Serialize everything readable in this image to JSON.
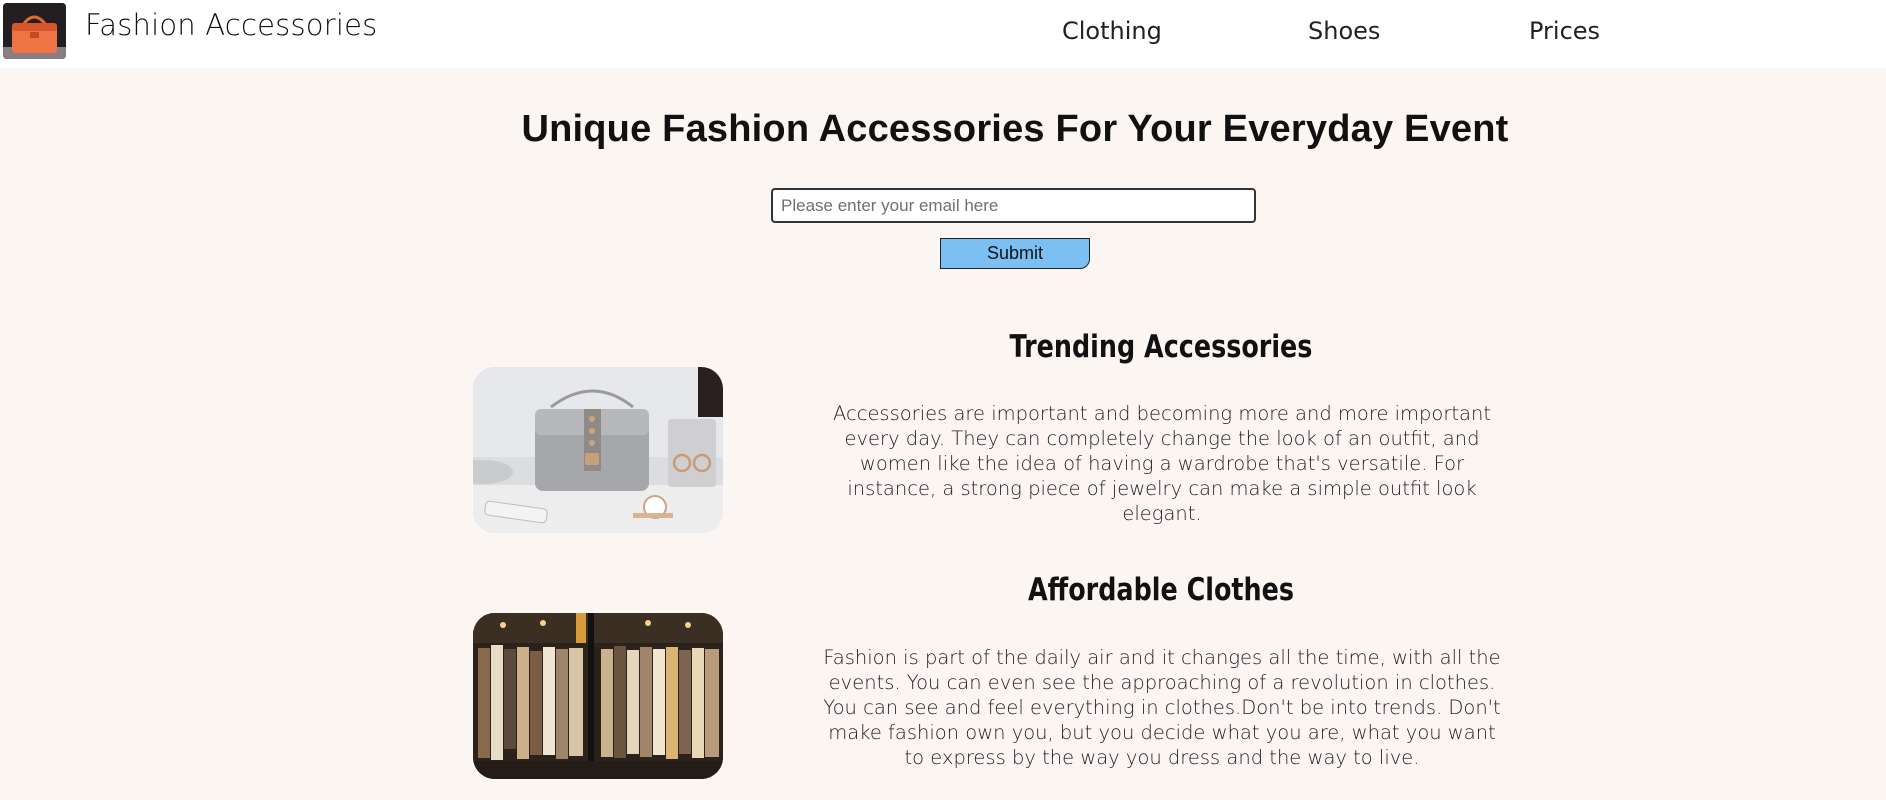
{
  "header": {
    "brand": "Fashion Accessories",
    "nav": {
      "clothing": "Clothing",
      "shoes": "Shoes",
      "prices": "Prices"
    }
  },
  "hero": {
    "title": "Unique Fashion Accessories For Your Everyday Event",
    "email_placeholder": "Please enter your email here",
    "submit_label": "Submit"
  },
  "sections": [
    {
      "title": "Trending Accessories",
      "text": "Accessories are important and becoming more and more important every day. They can completely change the look of an outfit, and women like the idea of having a wardrobe that's versatile. For instance, a strong piece of jewelry can make a simple outfit look elegant."
    },
    {
      "title": "Affordable Clothes",
      "text": "Fashion is part of the daily air and it changes all the time, with all the events. You can even see the approaching of a revolution in clothes. You can see and feel everything in clothes.Don't be into trends. Don't make fashion own you, but you decide what you are, what you want to express by the way you dress and the way to live."
    }
  ],
  "colors": {
    "page_background": "#fcf6f3",
    "header_background": "#ffffff",
    "submit_button": "#7bbff3"
  }
}
